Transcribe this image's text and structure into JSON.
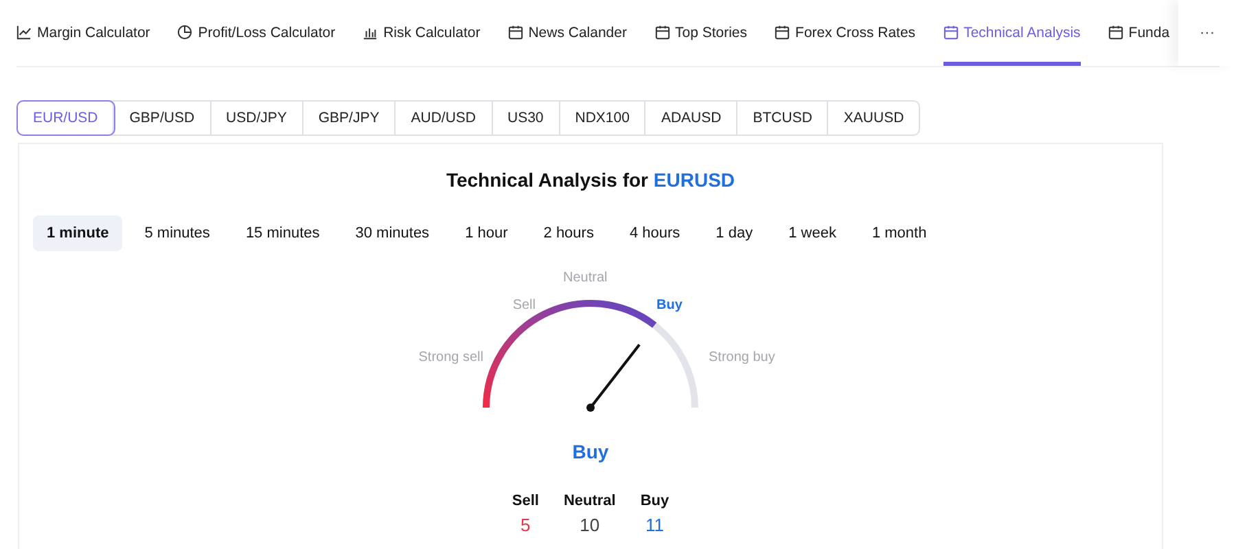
{
  "nav_tabs": [
    {
      "label": "Margin Calculator",
      "kind": "line",
      "selected": false
    },
    {
      "label": "Profit/Loss Calculator",
      "kind": "pie",
      "selected": false
    },
    {
      "label": "Risk Calculator",
      "kind": "bars",
      "selected": false
    },
    {
      "label": "News Calander",
      "kind": "calendar",
      "selected": false
    },
    {
      "label": "Top Stories",
      "kind": "calendar",
      "selected": false
    },
    {
      "label": "Forex Cross Rates",
      "kind": "calendar",
      "selected": false
    },
    {
      "label": "Technical Analysis",
      "kind": "calendar",
      "selected": true
    },
    {
      "label": "Funda",
      "kind": "calendar",
      "selected": false
    }
  ],
  "nav_more": "···",
  "symbols": [
    {
      "label": "EUR/USD",
      "selected": true
    },
    {
      "label": "GBP/USD",
      "selected": false
    },
    {
      "label": "USD/JPY",
      "selected": false
    },
    {
      "label": "GBP/JPY",
      "selected": false
    },
    {
      "label": "AUD/USD",
      "selected": false
    },
    {
      "label": "US30",
      "selected": false
    },
    {
      "label": "NDX100",
      "selected": false
    },
    {
      "label": "ADAUSD",
      "selected": false
    },
    {
      "label": "BTCUSD",
      "selected": false
    },
    {
      "label": "XAUUSD",
      "selected": false
    }
  ],
  "title": {
    "prefix": "Technical Analysis for",
    "symbol": "EURUSD"
  },
  "intervals": [
    {
      "label": "1 minute",
      "selected": true
    },
    {
      "label": "5 minutes",
      "selected": false
    },
    {
      "label": "15 minutes",
      "selected": false
    },
    {
      "label": "30 minutes",
      "selected": false
    },
    {
      "label": "1 hour",
      "selected": false
    },
    {
      "label": "2 hours",
      "selected": false
    },
    {
      "label": "4 hours",
      "selected": false
    },
    {
      "label": "1 day",
      "selected": false
    },
    {
      "label": "1 week",
      "selected": false
    },
    {
      "label": "1 month",
      "selected": false
    }
  ],
  "gauge": {
    "level": 0.71,
    "labels": [
      {
        "label": "Strong sell",
        "selected": false
      },
      {
        "label": "Sell",
        "selected": false
      },
      {
        "label": "Neutral",
        "selected": false
      },
      {
        "label": "Buy",
        "selected": true
      },
      {
        "label": "Strong buy",
        "selected": false
      }
    ],
    "verdict": "Buy"
  },
  "summary": [
    {
      "label": "Sell",
      "count": "5",
      "kind": "sell"
    },
    {
      "label": "Neutral",
      "count": "10",
      "kind": "neutral"
    },
    {
      "label": "Buy",
      "count": "11",
      "kind": "buy"
    }
  ]
}
